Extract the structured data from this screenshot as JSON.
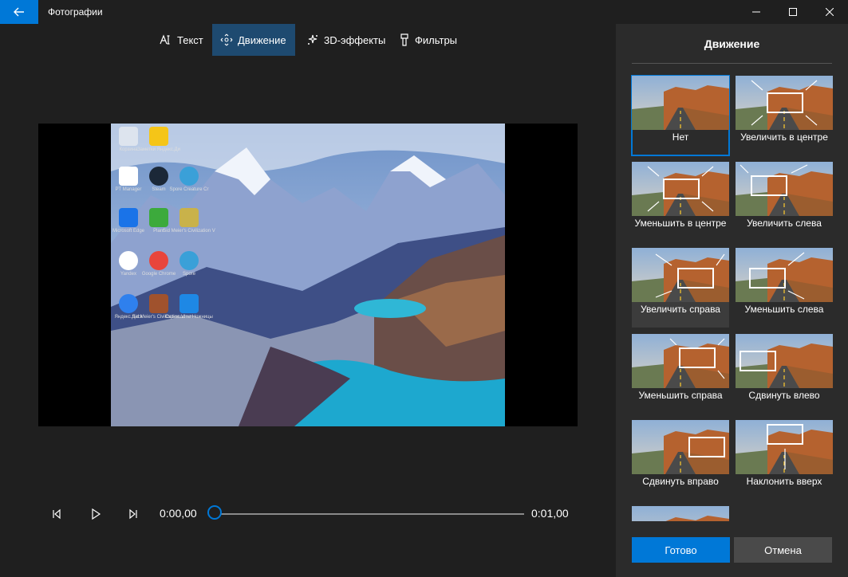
{
  "window": {
    "title": "Фотографии"
  },
  "toolbar": {
    "tabs": [
      {
        "label": "Текст",
        "icon": "text-icon"
      },
      {
        "label": "Движение",
        "icon": "motion-icon",
        "active": true
      },
      {
        "label": "3D-эффекты",
        "icon": "3d-effects-icon"
      },
      {
        "label": "Фильтры",
        "icon": "filters-icon"
      }
    ]
  },
  "desktop_icons": [
    {
      "label": "Корзина"
    },
    {
      "label": "Заметки Яндекс.Ди"
    },
    {
      "label": "РТ Manager"
    },
    {
      "label": "Steam"
    },
    {
      "label": "Spore Creature Cr"
    },
    {
      "label": "Microsoft Edge"
    },
    {
      "label": "Plant"
    },
    {
      "label": "Sid Meier's Civilization V"
    },
    {
      "label": "Yandex"
    },
    {
      "label": "Google Chrome"
    },
    {
      "label": "Spore"
    },
    {
      "label": "Яндекс.Диск"
    },
    {
      "label": "Sid Meier's Civilization VI"
    },
    {
      "label": "Скриншоты Ножницы"
    }
  ],
  "player": {
    "current_time": "0:00,00",
    "total_time": "0:01,00",
    "progress": 0
  },
  "panel": {
    "title": "Движение",
    "options": [
      {
        "label": "Нет",
        "selected": true
      },
      {
        "label": "Увеличить в центре"
      },
      {
        "label": "Уменьшить в центре"
      },
      {
        "label": "Увеличить слева"
      },
      {
        "label": "Увеличить справа",
        "hover": true
      },
      {
        "label": "Уменьшить слева"
      },
      {
        "label": "Уменьшить справа"
      },
      {
        "label": "Сдвинуть влево"
      },
      {
        "label": "Сдвинуть вправо"
      },
      {
        "label": "Наклонить вверх"
      }
    ],
    "done_label": "Готово",
    "cancel_label": "Отмена"
  },
  "colors": {
    "accent": "#0078d7",
    "background": "#1f1f1f",
    "panel": "#2b2b2b"
  }
}
